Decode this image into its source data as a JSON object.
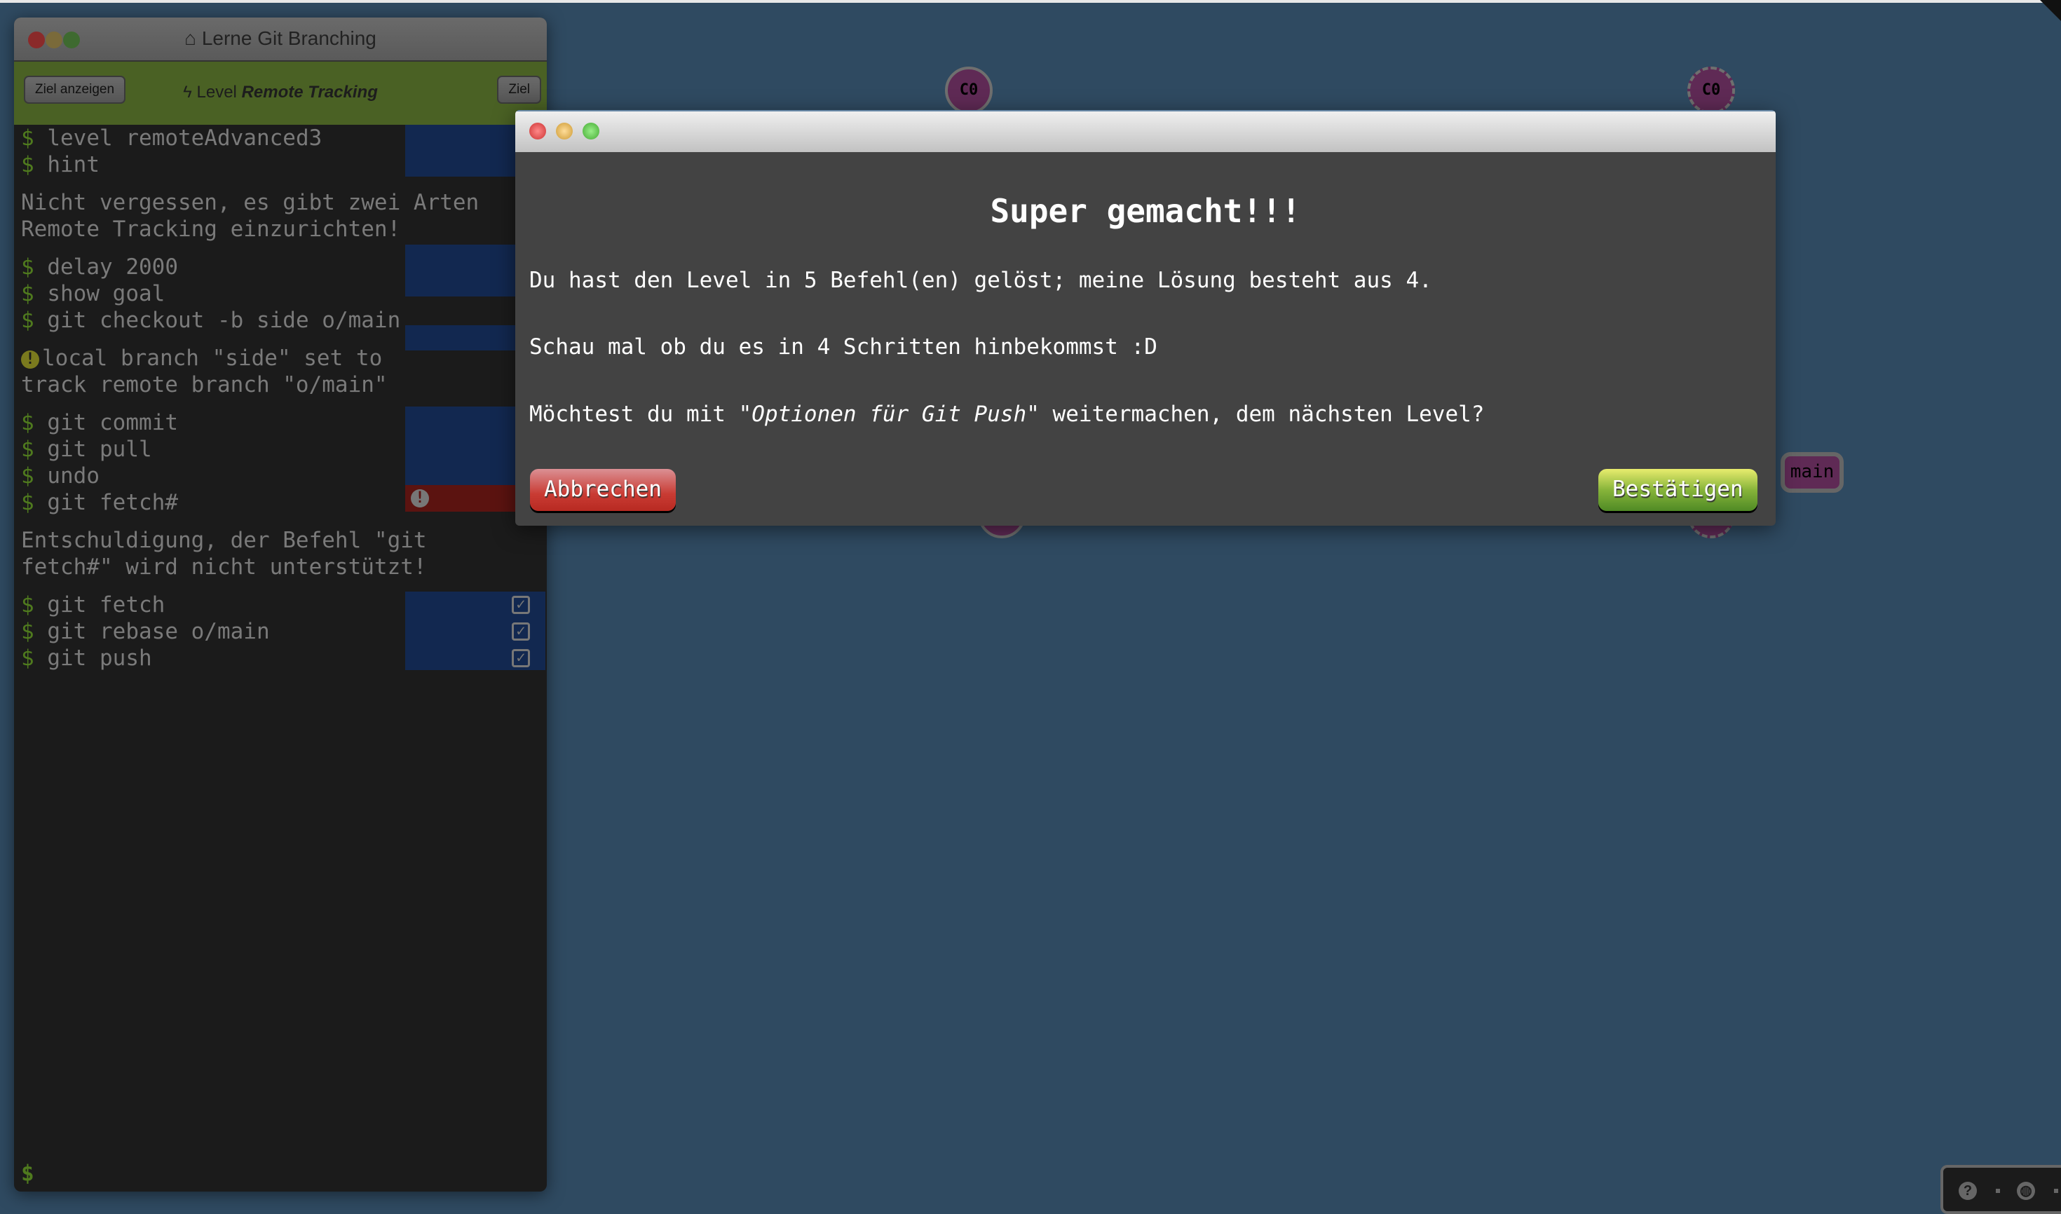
{
  "terminal": {
    "title": "Lerne Git Branching",
    "show_goal_button": "Ziel anzeigen",
    "level_prefix": "Level",
    "level_name": "Remote Tracking",
    "goal_button": "Ziel",
    "prompt": "$",
    "lines": [
      {
        "type": "cmd",
        "text": "level remoteAdvanced3"
      },
      {
        "type": "cmd",
        "text": "hint"
      },
      {
        "type": "out",
        "text": "Nicht vergessen, es gibt zwei Arten"
      },
      {
        "type": "out",
        "text": "Remote Tracking einzurichten!"
      },
      {
        "type": "cmd",
        "text": "delay 2000"
      },
      {
        "type": "cmd",
        "text": "show goal"
      },
      {
        "type": "cmd",
        "text": "git checkout -b side o/main"
      },
      {
        "type": "warn",
        "text": "local branch \"side\" set to"
      },
      {
        "type": "out",
        "text": "track remote branch \"o/main\""
      },
      {
        "type": "cmd",
        "text": "git commit"
      },
      {
        "type": "cmd",
        "text": "git pull"
      },
      {
        "type": "cmd",
        "text": "undo"
      },
      {
        "type": "cmd",
        "text": "git fetch#"
      },
      {
        "type": "out",
        "text": "Entschuldigung, der Befehl \"git"
      },
      {
        "type": "out",
        "text": "fetch#\" wird nicht unterstützt!"
      },
      {
        "type": "cmd",
        "text": "git fetch"
      },
      {
        "type": "cmd",
        "text": "git rebase o/main"
      },
      {
        "type": "cmd",
        "text": "git push"
      }
    ]
  },
  "graph": {
    "commits": [
      {
        "label": "C0"
      },
      {
        "label": "C0"
      }
    ],
    "branch": "main"
  },
  "dialog": {
    "title": "Super gemacht!!!",
    "line1": "Du hast den Level in 5 Befehl(en) gelöst; meine Lösung besteht aus 4.",
    "line2": "Schau mal ob du es in 4 Schritten hinbekommst :D",
    "line3_pre": "Möchtest du mit \"",
    "line3_em": "Optionen für Git Push",
    "line3_post": "\" weitermachen, dem nächsten Level?",
    "cancel": "Abbrechen",
    "confirm": "Bestätigen"
  },
  "helper": {
    "icons": [
      "help-icon",
      "globe-icon"
    ]
  },
  "colors": {
    "background": "#2f4a61",
    "commit": "#5f2a55",
    "level_bar": "#4a6124",
    "terminal": "#1b1b1b"
  }
}
